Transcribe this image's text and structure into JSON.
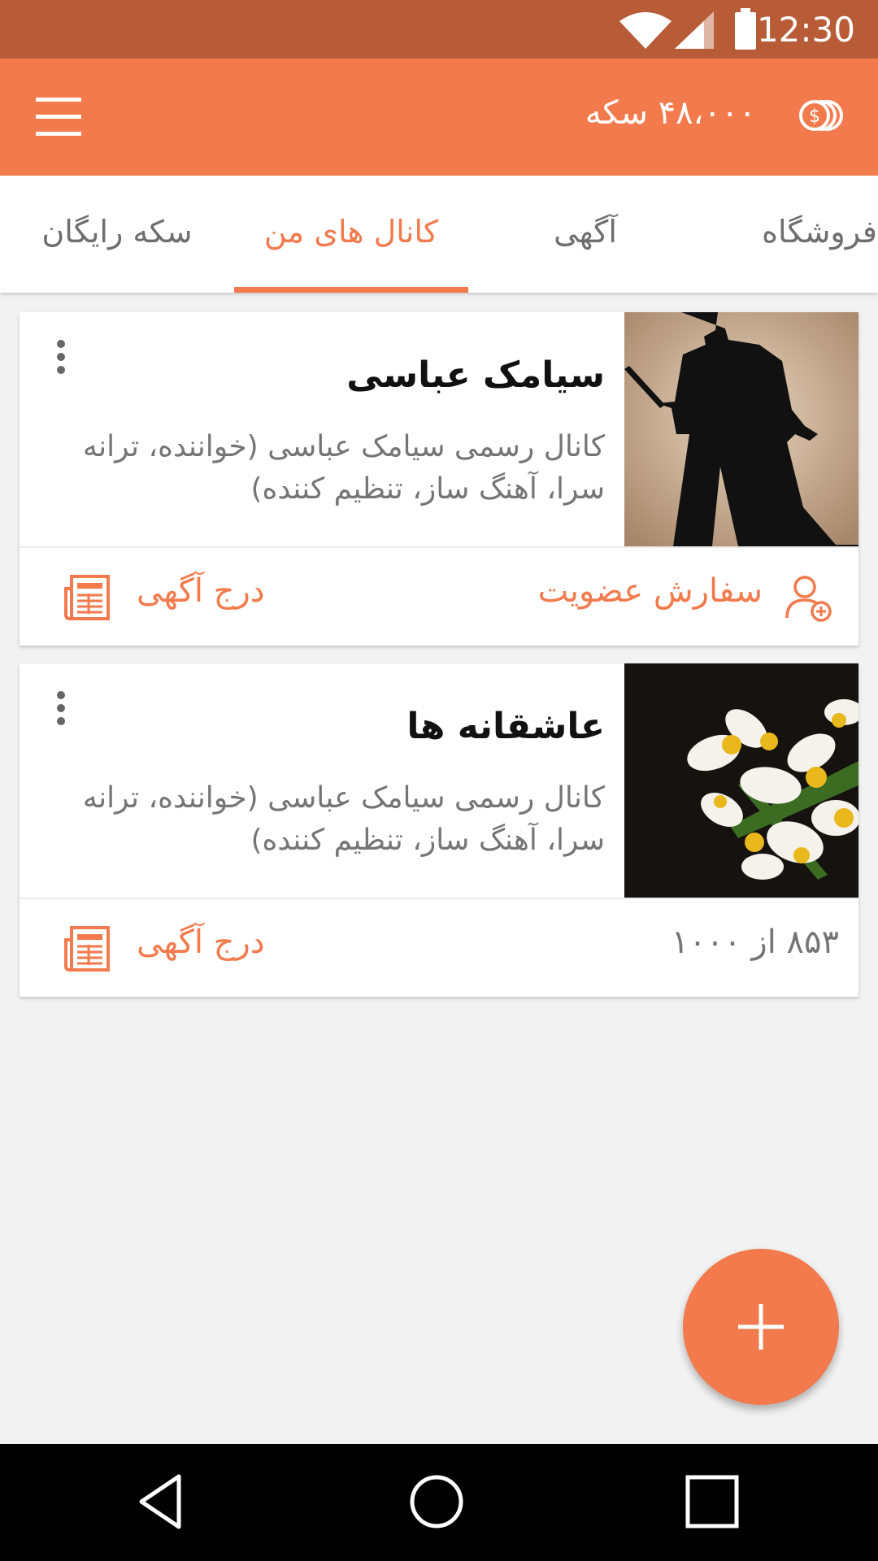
{
  "status_bar": {
    "time": "12:30",
    "icons": [
      "wifi-icon",
      "signal-icon",
      "battery-icon"
    ]
  },
  "app_bar": {
    "coins_text": "۴۸،۰۰۰ سکه",
    "menu_icon": "hamburger-icon",
    "coin_icon": "coins-icon"
  },
  "tabs": [
    {
      "label": "فروشگاه",
      "active": false
    },
    {
      "label": "آگهی",
      "active": false
    },
    {
      "label": "کانال های من",
      "active": true
    },
    {
      "label": "سکه رایگان",
      "active": false
    }
  ],
  "channels": [
    {
      "title": "سیامک عباسی",
      "description": "کانال رسمی سیامک عباسی (خواننده، ترانه سرا، آهنگ ساز، تنظیم کننده)",
      "image": "silhouette-image",
      "order_label": "سفارش عضویت",
      "ad_label": "درج آگهی"
    },
    {
      "title": "عاشقانه ها",
      "description": "کانال رسمی سیامک عباسی (خواننده، ترانه سرا، آهنگ ساز، تنظیم کننده)",
      "image": "flowers-image",
      "count_text": "۸۵۳ از ۱۰۰۰",
      "ad_label": "درج آگهی"
    }
  ],
  "fab": {
    "icon": "plus-icon"
  },
  "nav_bar": {
    "icons": [
      "back-icon",
      "home-icon",
      "recents-icon"
    ]
  },
  "colors": {
    "primary": "#f27a4c",
    "status_bar": "#b85c38",
    "background": "#f2f2f2"
  }
}
